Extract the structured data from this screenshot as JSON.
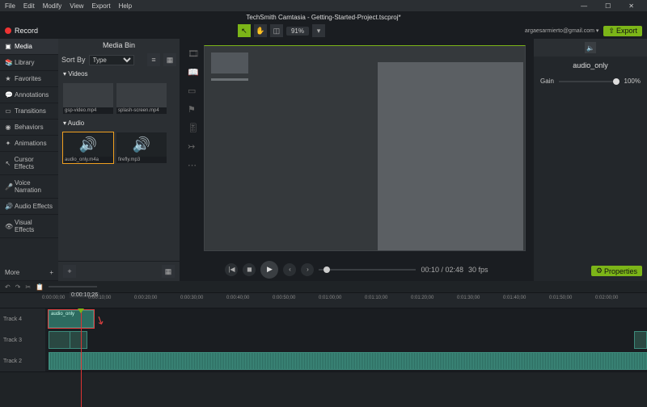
{
  "menu": {
    "file": "File",
    "edit": "Edit",
    "modify": "Modify",
    "view": "View",
    "export": "Export",
    "help": "Help"
  },
  "window": {
    "title": "TechSmith Camtasia - Getting-Started-Project.tscproj*",
    "min": "—",
    "max": "☐",
    "close": "✕"
  },
  "toolbar": {
    "record": "Record",
    "zoom": "91%",
    "account": "argaesarmierto@gmail.com ▾",
    "export": "Export"
  },
  "sidebar": {
    "tabs": [
      {
        "icon": "▣",
        "label": "Media"
      },
      {
        "icon": "📚",
        "label": "Library"
      },
      {
        "icon": "★",
        "label": "Favorites"
      },
      {
        "icon": "💬",
        "label": "Annotations"
      },
      {
        "icon": "▭",
        "label": "Transitions"
      },
      {
        "icon": "◉",
        "label": "Behaviors"
      },
      {
        "icon": "✦",
        "label": "Animations"
      },
      {
        "icon": "↖",
        "label": "Cursor Effects"
      },
      {
        "icon": "🎤",
        "label": "Voice Narration"
      },
      {
        "icon": "🔊",
        "label": "Audio Effects"
      },
      {
        "icon": "👁",
        "label": "Visual Effects"
      }
    ],
    "more": "More",
    "plus": "+"
  },
  "bin": {
    "title": "Media Bin",
    "sortby": "Sort By",
    "sorttype": "Type",
    "cat_video": "▾ Videos",
    "cat_audio": "▾ Audio",
    "videos": [
      {
        "name": "gsp-video.mp4"
      },
      {
        "name": "splash-screen.mp4"
      }
    ],
    "audios": [
      {
        "name": "audio_only.m4a"
      },
      {
        "name": "firefly.mp3"
      }
    ],
    "speaker": "🔊"
  },
  "props": {
    "vol_icon": "🔈",
    "sel_name": "audio_only",
    "gain_label": "Gain",
    "gain_value": "100%",
    "button": "Properties",
    "gear": "⚙"
  },
  "playback": {
    "prev": "|◀",
    "stop": "◼",
    "play": "▶",
    "back": "‹",
    "fwd": "›",
    "time": "00:10 / 02:48",
    "fps": "30 fps"
  },
  "timeline": {
    "undo": "↶",
    "redo": "↷",
    "cut": "✂",
    "paste": "📋",
    "playhead_time": "0:00:10;26",
    "ticks": [
      "0:00:00;00",
      "0:00:10;00",
      "0:00:20;00",
      "0:00:30;00",
      "0:00:40;00",
      "0:00:50;00",
      "0:01:00;00",
      "0:01:10;00",
      "0:01:20;00",
      "0:01:30;00",
      "0:01:40;00",
      "0:01:50;00",
      "0:02:00;00"
    ],
    "tracks": [
      {
        "name": "Track 4"
      },
      {
        "name": "Track 3"
      },
      {
        "name": "Track 2"
      }
    ],
    "clip4": "audio_only"
  }
}
